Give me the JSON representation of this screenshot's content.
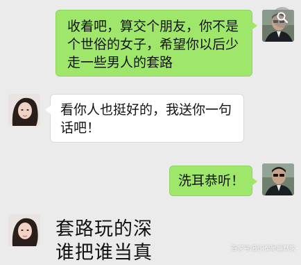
{
  "messages": [
    {
      "side": "out",
      "text": "收着吧，算交个朋友，你不是\n个世俗的女子，希望你以后少\n走一些男人的套路"
    },
    {
      "side": "in",
      "text": "看你人也挺好的，我送你一句\n话吧！"
    },
    {
      "side": "out",
      "text": "洗耳恭听！"
    }
  ],
  "partial_message": {
    "text": "套路玩的深\n谁把谁当真"
  },
  "watermark": "百家号/我们都是幽默家",
  "colors": {
    "background": "#ebebeb",
    "outgoing_bubble": "#9fe76b",
    "incoming_bubble": "#ffffff"
  },
  "icons": {
    "search_badge": "search-icon"
  }
}
